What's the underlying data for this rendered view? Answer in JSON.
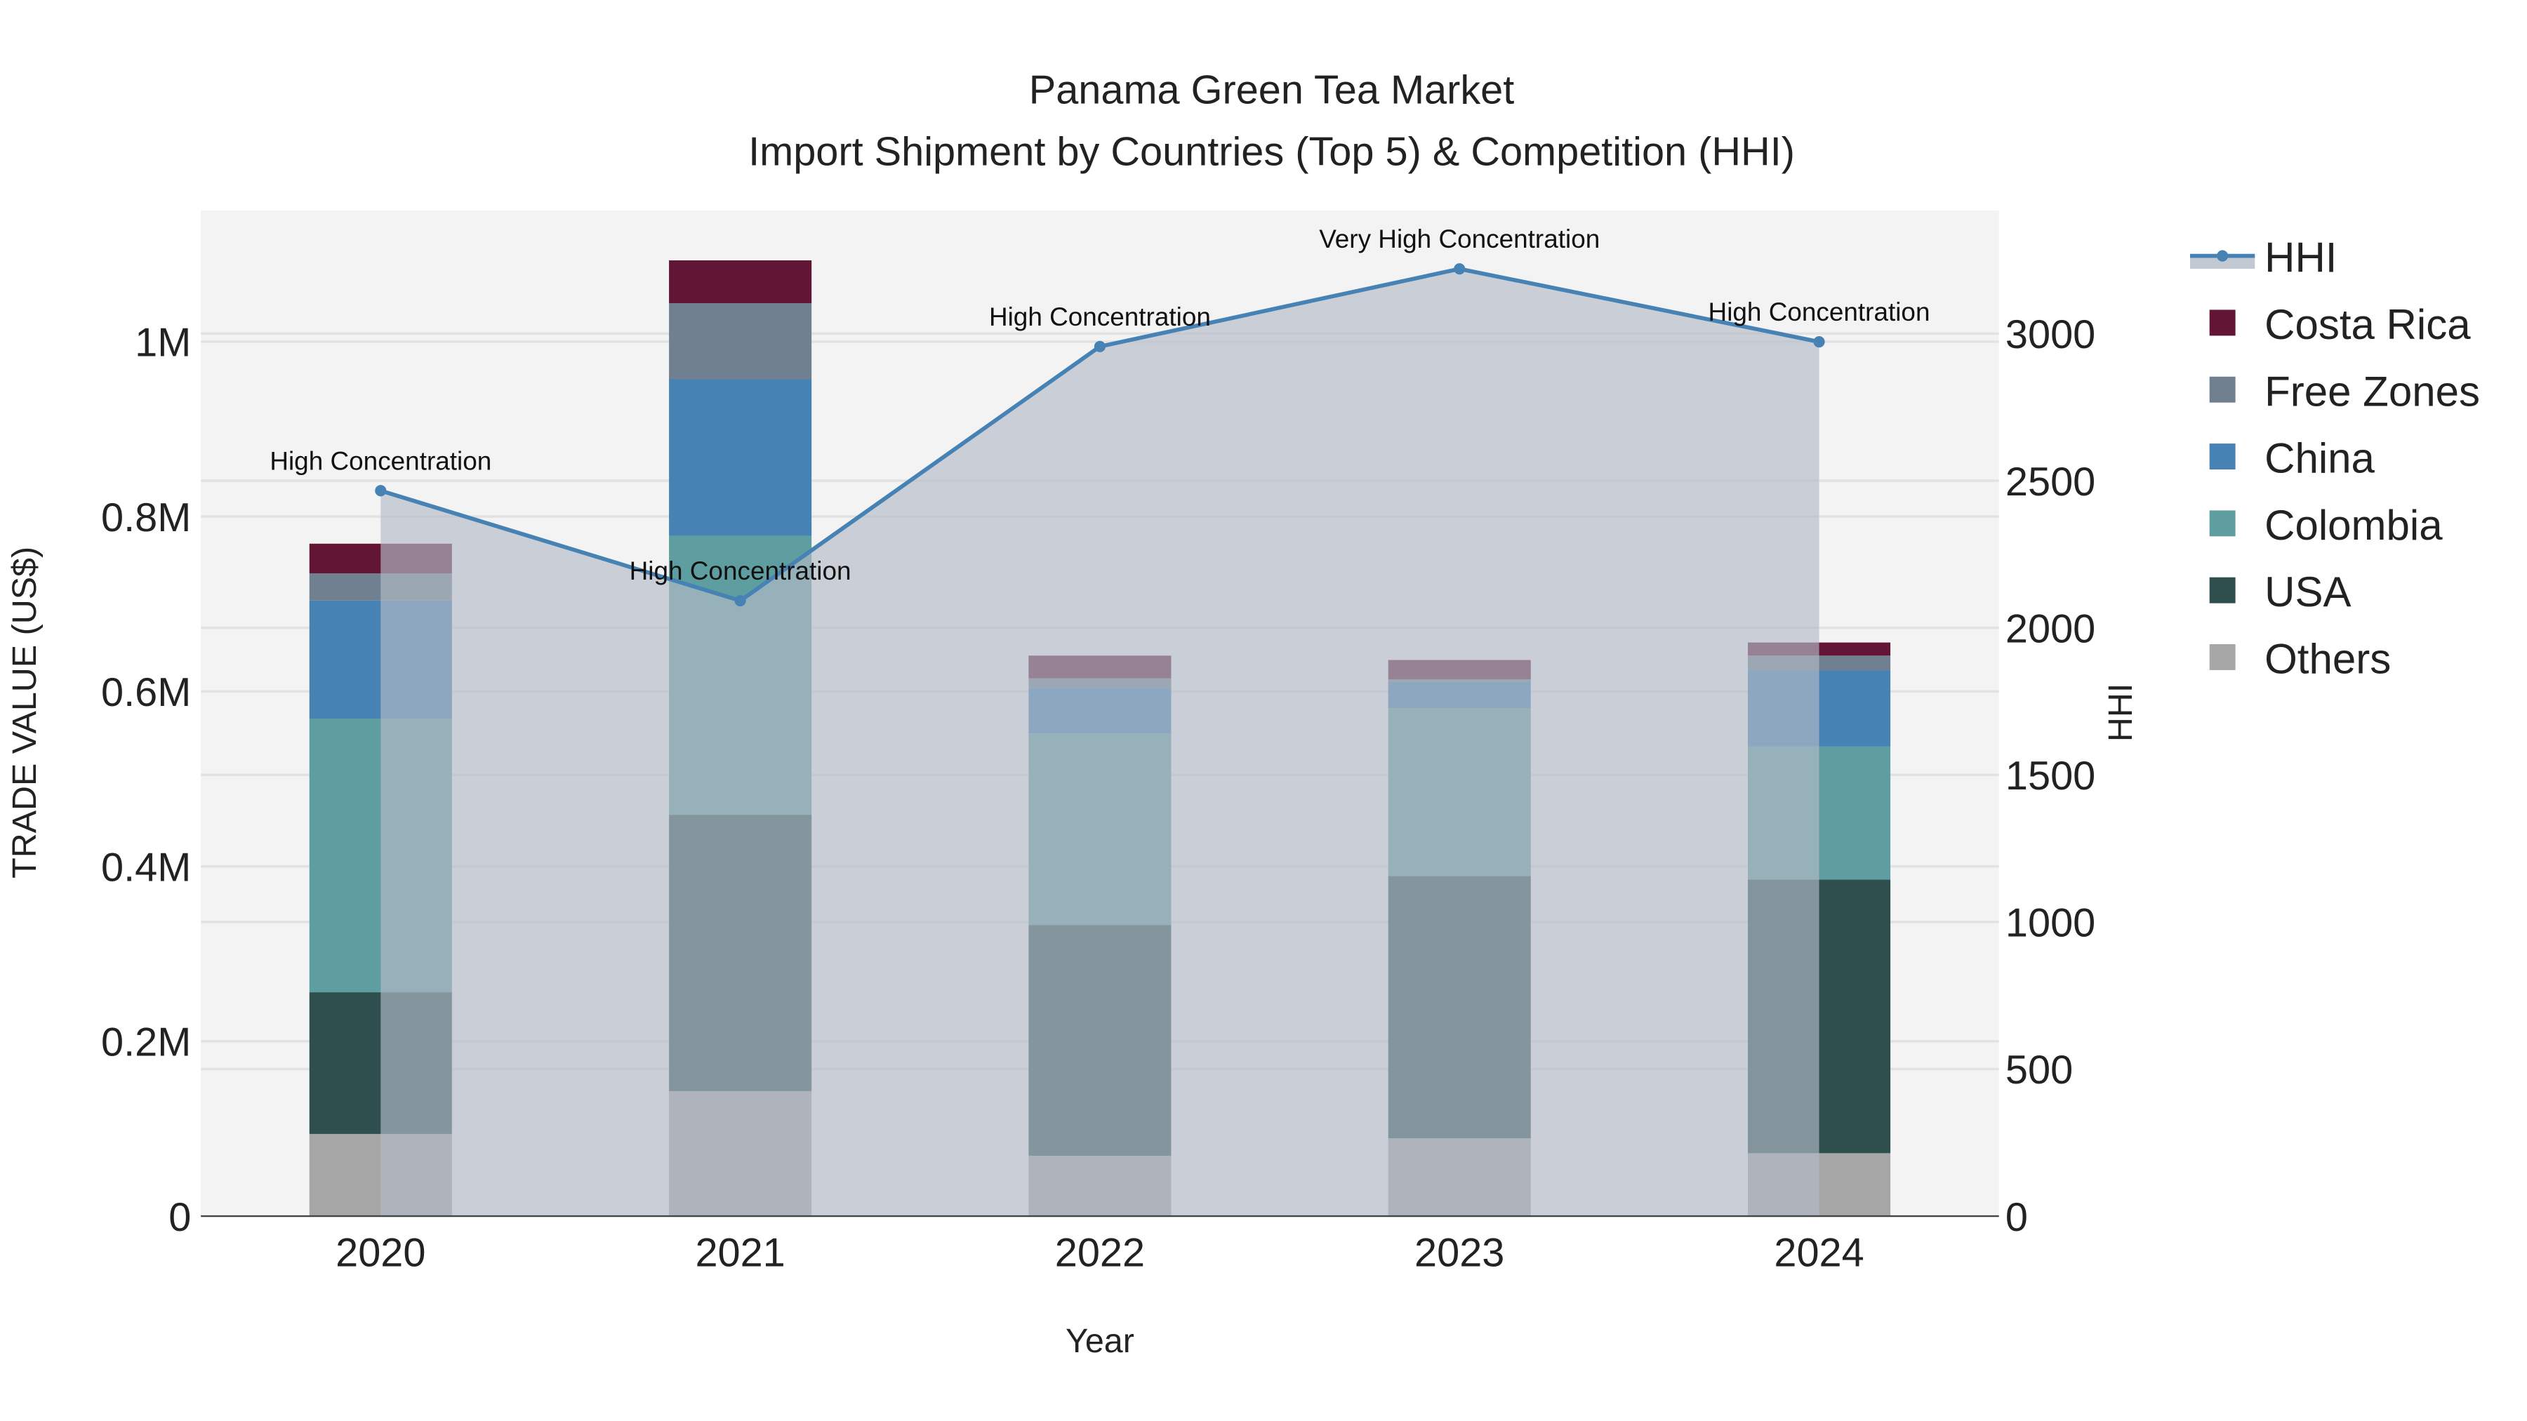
{
  "chart_data": {
    "type": "bar",
    "title": "Panama Green Tea Market",
    "subtitle": "Import Shipment by Countries (Top 5) & Competition (HHI)",
    "xlabel": "Year",
    "ylabel": "TRADE VALUE (US$)",
    "y2label": "HHI",
    "categories": [
      "2020",
      "2021",
      "2022",
      "2023",
      "2024"
    ],
    "ylim": [
      0,
      1140000
    ],
    "y2lim": [
      0,
      3420
    ],
    "yticks": [
      {
        "v": 0,
        "label": "0"
      },
      {
        "v": 200000,
        "label": "0.2M"
      },
      {
        "v": 400000,
        "label": "0.4M"
      },
      {
        "v": 600000,
        "label": "0.6M"
      },
      {
        "v": 800000,
        "label": "0.8M"
      },
      {
        "v": 1000000,
        "label": "1M"
      }
    ],
    "y2ticks": [
      {
        "v": 0,
        "label": "0"
      },
      {
        "v": 500,
        "label": "500"
      },
      {
        "v": 1000,
        "label": "1000"
      },
      {
        "v": 1500,
        "label": "1500"
      },
      {
        "v": 2000,
        "label": "2000"
      },
      {
        "v": 2500,
        "label": "2500"
      },
      {
        "v": 3000,
        "label": "3000"
      }
    ],
    "series": [
      {
        "name": "Others",
        "color": "#a6a6a6",
        "values": [
          94000,
          143000,
          69000,
          89000,
          72000
        ]
      },
      {
        "name": "USA",
        "color": "#2f4f4f",
        "values": [
          162000,
          316000,
          264000,
          300000,
          313000
        ]
      },
      {
        "name": "Colombia",
        "color": "#5f9ea0",
        "values": [
          313000,
          319000,
          219000,
          192000,
          152000
        ]
      },
      {
        "name": "China",
        "color": "#4682b4",
        "values": [
          135000,
          179000,
          52000,
          30000,
          87000
        ]
      },
      {
        "name": "Free Zones",
        "color": "#708090",
        "values": [
          31000,
          87000,
          11000,
          3000,
          17000
        ]
      },
      {
        "name": "Costa Rica",
        "color": "#631535",
        "values": [
          34000,
          49000,
          26000,
          22000,
          15000
        ]
      }
    ],
    "hhi": {
      "name": "HHI",
      "color": "#4682b4",
      "values": [
        2466,
        2092,
        2956,
        3220,
        2972
      ],
      "annotations": [
        "High Concentration",
        "High Concentration",
        "High Concentration",
        "Very High Concentration",
        "High Concentration"
      ]
    },
    "legend": [
      "HHI",
      "Costa Rica",
      "Free Zones",
      "China",
      "Colombia",
      "USA",
      "Others"
    ],
    "legend_position": "right",
    "grid": true
  }
}
